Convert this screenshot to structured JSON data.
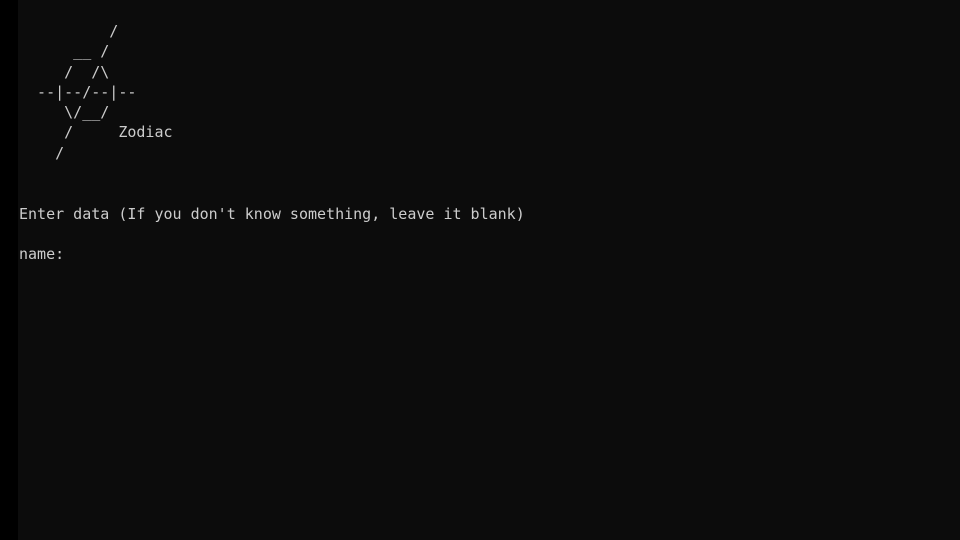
{
  "terminal": {
    "banner": [
      "          /",
      "      __ /",
      "     /  /\\",
      "  --|--/--|--",
      "     \\/__/",
      "     /     Zodiac",
      "    /"
    ],
    "instruction": "Enter data (If you don't know something, leave it blank)",
    "prompt": "name:"
  },
  "colors": {
    "background": "#0c0c0c",
    "foreground": "#cccccc"
  }
}
